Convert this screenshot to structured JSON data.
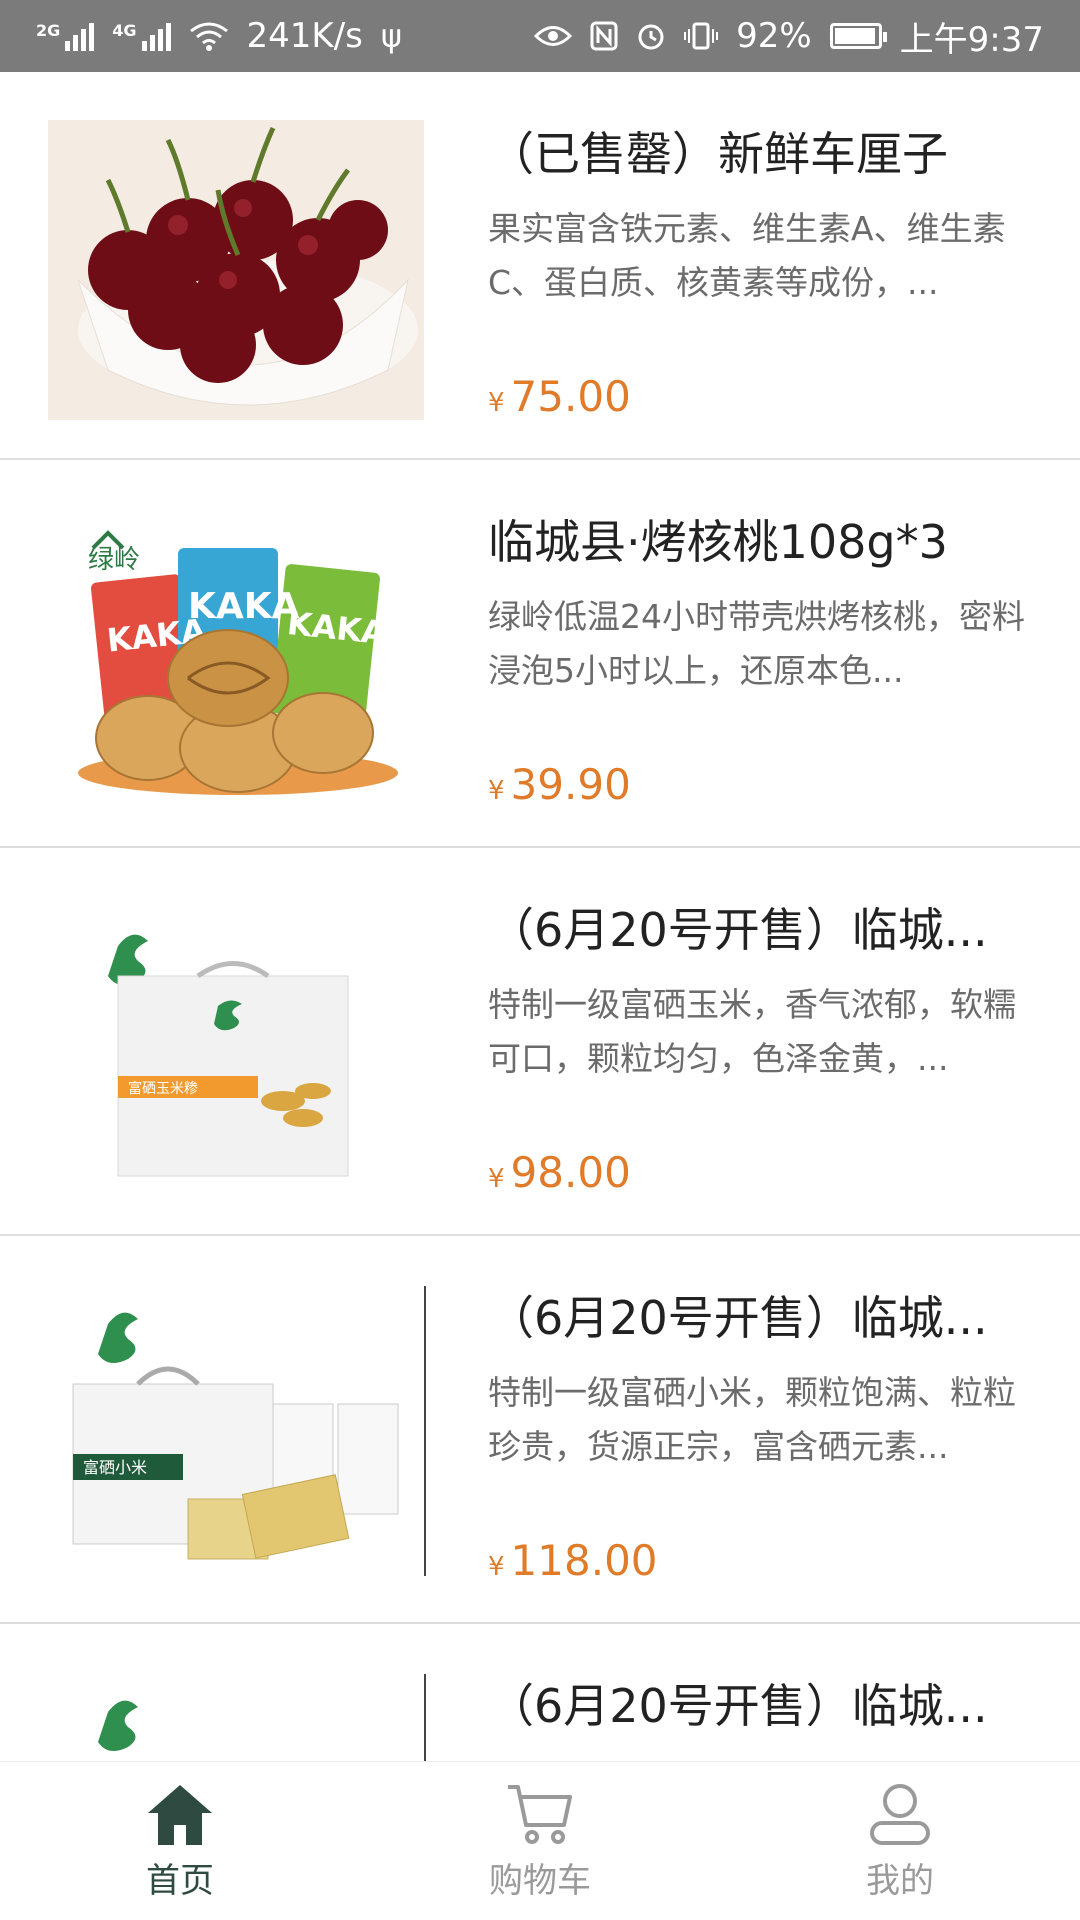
{
  "status_bar": {
    "network_left": "2G",
    "network_right": "4G",
    "speed": "241K/s",
    "battery": "92%",
    "time": "上午9:37"
  },
  "products": [
    {
      "title": "（已售罄）新鲜车厘子",
      "desc": "果实富含铁元素、维生素A、维生素C、蛋白质、核黄素等成份，...",
      "currency": "¥",
      "price": "75.00"
    },
    {
      "title": "临城县·烤核桃108g*3",
      "desc": "绿岭低温24小时带壳烘烤核桃，密料浸泡5小时以上，还原本色...",
      "currency": "¥",
      "price": "39.90",
      "logo_text": "绿岭",
      "package_text": "KAKA"
    },
    {
      "title": "（6月20号开售）临城...",
      "desc": "特制一级富硒玉米，香气浓郁，软糯可口，颗粒均匀，色泽金黄，...",
      "currency": "¥",
      "price": "98.00",
      "box_label": "富硒玉米糁"
    },
    {
      "title": "（6月20号开售）临城...",
      "desc": "特制一级富硒小米，颗粒饱满、粒粒珍贵，货源正宗，富含硒元素...",
      "currency": "¥",
      "price": "118.00",
      "box_label": "富硒小米"
    },
    {
      "title": "（6月20号开售）临城..."
    }
  ],
  "tabs": [
    {
      "label": "首页",
      "icon": "home-icon"
    },
    {
      "label": "购物车",
      "icon": "cart-icon"
    },
    {
      "label": "我的",
      "icon": "user-icon"
    }
  ],
  "colors": {
    "status_bar_bg": "#7b7b7b",
    "price": "#e07b2a",
    "tab_active": "#2f4a40",
    "tab_inactive": "#9a9a9a"
  }
}
